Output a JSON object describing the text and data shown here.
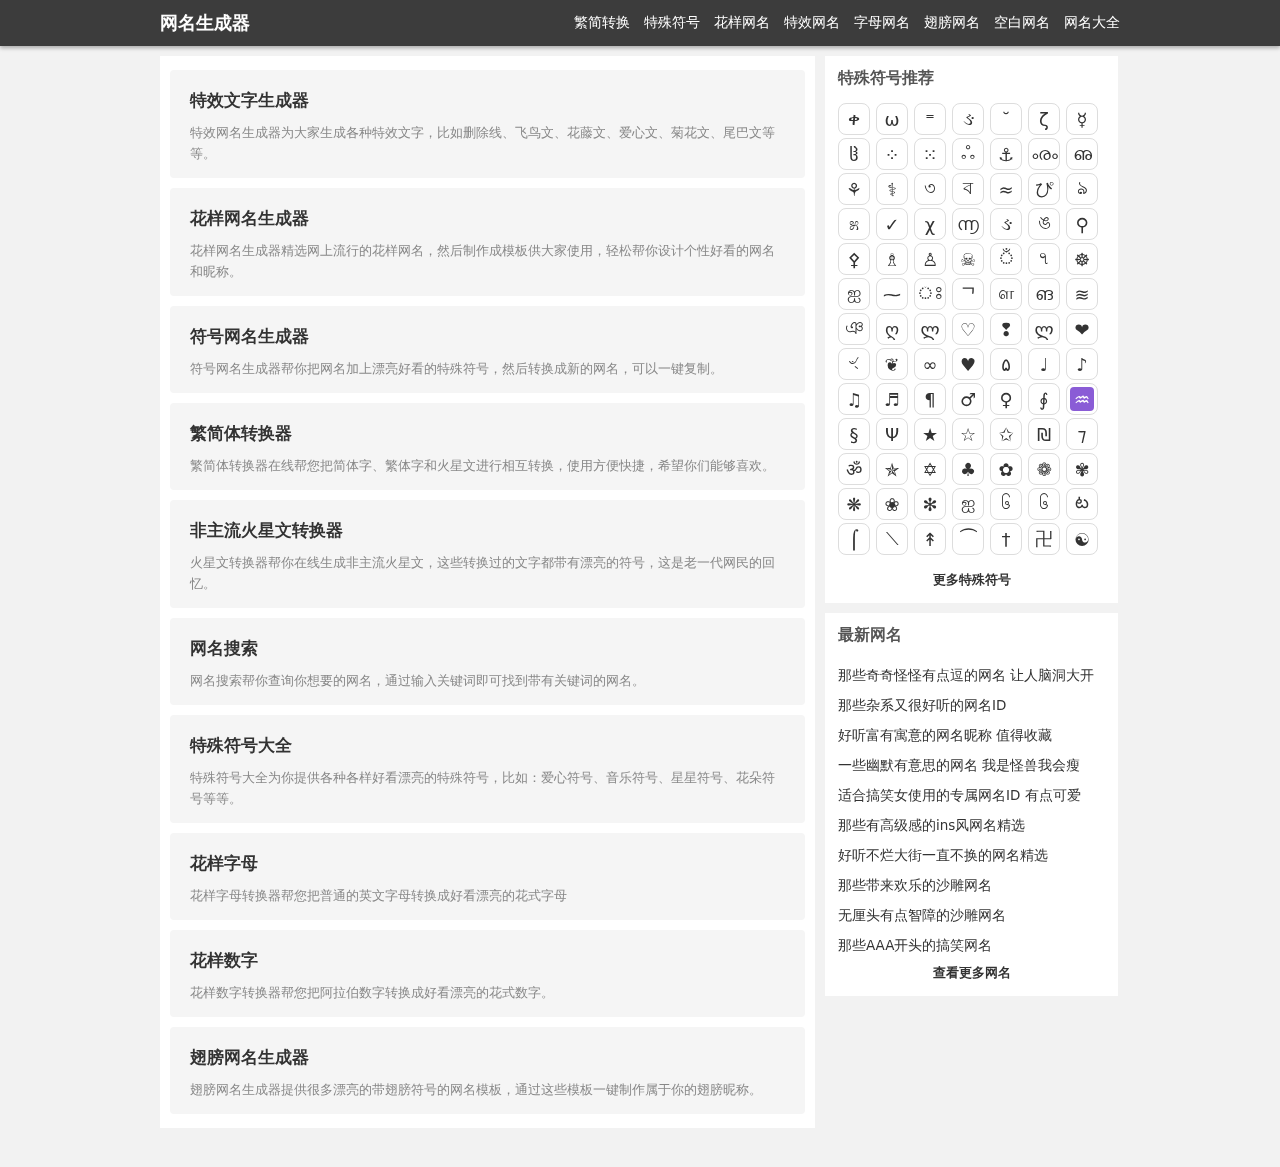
{
  "header": {
    "logo": "网名生成器",
    "nav": [
      {
        "label": "繁简转换"
      },
      {
        "label": "特殊符号"
      },
      {
        "label": "花样网名"
      },
      {
        "label": "特效网名"
      },
      {
        "label": "字母网名"
      },
      {
        "label": "翅膀网名"
      },
      {
        "label": "空白网名"
      },
      {
        "label": "网名大全"
      }
    ]
  },
  "tools": [
    {
      "title": "特效文字生成器",
      "description": "特效网名生成器为大家生成各种特效文字，比如删除线、飞鸟文、花藤文、爱心文、菊花文、尾巴文等等。"
    },
    {
      "title": "花样网名生成器",
      "description": "花样网名生成器精选网上流行的花样网名，然后制作成模板供大家使用，轻松帮你设计个性好看的网名和昵称。"
    },
    {
      "title": "符号网名生成器",
      "description": "符号网名生成器帮你把网名加上漂亮好看的特殊符号，然后转换成新的网名，可以一键复制。"
    },
    {
      "title": "繁简体转换器",
      "description": "繁简体转换器在线帮您把简体字、繁体字和火星文进行相互转换，使用方便快捷，希望你们能够喜欢。"
    },
    {
      "title": "非主流火星文转换器",
      "description": "火星文转换器帮你在线生成非主流火星文，这些转换过的文字都带有漂亮的符号，这是老一代网民的回忆。"
    },
    {
      "title": "网名搜索",
      "description": "网名搜索帮你查询你想要的网名，通过输入关键词即可找到带有关键词的网名。"
    },
    {
      "title": "特殊符号大全",
      "description": "特殊符号大全为你提供各种各样好看漂亮的特殊符号，比如：爱心符号、音乐符号、星星符号、花朵符号等等。"
    },
    {
      "title": "花样字母",
      "description": "花样字母转换器帮您把普通的英文字母转换成好看漂亮的花式字母"
    },
    {
      "title": "花样数字",
      "description": "花样数字转换器帮您把阿拉伯数字转换成好看漂亮的花式数字。"
    },
    {
      "title": "翅膀网名生成器",
      "description": "翅膀网名生成器提供很多漂亮的带翅膀符号的网名模板，通过这些模板一键制作属于你的翅膀昵称。"
    }
  ],
  "symbols_panel": {
    "title": "特殊符号推荐",
    "symbols": [
      {
        "s": "ቀ",
        "kind": "plain"
      },
      {
        "s": "ω",
        "kind": "plain"
      },
      {
        "s": "⁼",
        "kind": "plain"
      },
      {
        "s": "ઙ",
        "kind": "plain"
      },
      {
        "s": "˘",
        "kind": "plain"
      },
      {
        "s": "ζ",
        "kind": "plain"
      },
      {
        "s": "☿",
        "kind": "plain"
      },
      {
        "s": "ჱ",
        "kind": "plain"
      },
      {
        "s": "⁘",
        "kind": "plain"
      },
      {
        "s": "⁙",
        "kind": "plain"
      },
      {
        "s": "ஃ",
        "kind": "plain"
      },
      {
        "s": "⚓",
        "kind": "plain"
      },
      {
        "s": "ൟ",
        "kind": "plain"
      },
      {
        "s": "ഌ",
        "kind": "plain"
      },
      {
        "s": "⚘",
        "kind": "plain"
      },
      {
        "s": "⚕",
        "kind": "plain"
      },
      {
        "s": "৩",
        "kind": "plain"
      },
      {
        "s": "ব",
        "kind": "plain"
      },
      {
        "s": "≈",
        "kind": "plain"
      },
      {
        "s": "ぴ",
        "kind": "plain"
      },
      {
        "s": "ঌ",
        "kind": "plain"
      },
      {
        "s": "೫",
        "kind": "plain"
      },
      {
        "s": "✓",
        "kind": "plain"
      },
      {
        "s": "χ",
        "kind": "plain"
      },
      {
        "s": "൬",
        "kind": "plain"
      },
      {
        "s": "ઙ",
        "kind": "plain"
      },
      {
        "s": "ঙ",
        "kind": "plain"
      },
      {
        "s": "⚲",
        "kind": "plain"
      },
      {
        "s": "⚴",
        "kind": "plain"
      },
      {
        "s": "♗",
        "kind": "plain"
      },
      {
        "s": "♙",
        "kind": "plain"
      },
      {
        "s": "☠",
        "kind": "plain"
      },
      {
        "s": "ঁ",
        "kind": "plain"
      },
      {
        "s": "৭",
        "kind": "plain"
      },
      {
        "s": "☸",
        "kind": "plain"
      },
      {
        "s": "ஐ",
        "kind": "plain"
      },
      {
        "s": "⁓",
        "kind": "plain"
      },
      {
        "s": "ঃ",
        "kind": "plain"
      },
      {
        "s": "ᄀ",
        "kind": "plain"
      },
      {
        "s": "ள",
        "kind": "plain"
      },
      {
        "s": "ങ",
        "kind": "plain"
      },
      {
        "s": "≋",
        "kind": "plain"
      },
      {
        "s": "ঞ",
        "kind": "plain"
      },
      {
        "s": "ღ",
        "kind": "plain"
      },
      {
        "s": "ლ",
        "kind": "plain"
      },
      {
        "s": "♡",
        "kind": "plain"
      },
      {
        "s": "❢",
        "kind": "plain"
      },
      {
        "s": "ლ",
        "kind": "plain"
      },
      {
        "s": "❤",
        "kind": "plain"
      },
      {
        "s": "ৼ",
        "kind": "plain"
      },
      {
        "s": "❦",
        "kind": "plain"
      },
      {
        "s": "∞",
        "kind": "plain"
      },
      {
        "s": "♥",
        "kind": "plain"
      },
      {
        "s": "۵",
        "kind": "plain"
      },
      {
        "s": "♩",
        "kind": "plain"
      },
      {
        "s": "♪",
        "kind": "plain"
      },
      {
        "s": "♫",
        "kind": "plain"
      },
      {
        "s": "♬",
        "kind": "plain"
      },
      {
        "s": "¶",
        "kind": "plain"
      },
      {
        "s": "♂",
        "kind": "plain"
      },
      {
        "s": "♀",
        "kind": "plain"
      },
      {
        "s": "∮",
        "kind": "plain"
      },
      {
        "s": "♒",
        "kind": "tile"
      },
      {
        "s": "§",
        "kind": "plain"
      },
      {
        "s": "Ψ",
        "kind": "plain"
      },
      {
        "s": "★",
        "kind": "plain"
      },
      {
        "s": "☆",
        "kind": "plain"
      },
      {
        "s": "✩",
        "kind": "plain"
      },
      {
        "s": "₪",
        "kind": "plain"
      },
      {
        "s": "⁊",
        "kind": "plain"
      },
      {
        "s": "ॐ",
        "kind": "plain"
      },
      {
        "s": "✯",
        "kind": "plain"
      },
      {
        "s": "✡",
        "kind": "plain"
      },
      {
        "s": "♣",
        "kind": "plain"
      },
      {
        "s": "✿",
        "kind": "plain"
      },
      {
        "s": "❁",
        "kind": "plain"
      },
      {
        "s": "✾",
        "kind": "plain"
      },
      {
        "s": "❋",
        "kind": "plain"
      },
      {
        "s": "❀",
        "kind": "plain"
      },
      {
        "s": "✻",
        "kind": "plain"
      },
      {
        "s": "ஐ",
        "kind": "plain"
      },
      {
        "s": "၆",
        "kind": "plain"
      },
      {
        "s": "၆",
        "kind": "plain"
      },
      {
        "s": "ట",
        "kind": "plain"
      },
      {
        "s": "⌠",
        "kind": "plain"
      },
      {
        "s": "⟍",
        "kind": "plain"
      },
      {
        "s": "↟",
        "kind": "plain"
      },
      {
        "s": "⏜",
        "kind": "plain"
      },
      {
        "s": "†",
        "kind": "plain"
      },
      {
        "s": "卍",
        "kind": "plain"
      },
      {
        "s": "☯",
        "kind": "plain"
      }
    ],
    "more": "更多特殊符号"
  },
  "latest_panel": {
    "title": "最新网名",
    "items": [
      "那些奇奇怪怪有点逗的网名 让人脑洞大开",
      "那些杂系又很好听的网名ID",
      "好听富有寓意的网名昵称 值得收藏",
      "一些幽默有意思的网名 我是怪兽我会瘦",
      "适合搞笑女使用的专属网名ID 有点可爱",
      "那些有高级感的ins风网名精选",
      "好听不烂大街一直不换的网名精选",
      "那些带来欢乐的沙雕网名",
      "无厘头有点智障的沙雕网名",
      "那些AAA开头的搞笑网名"
    ],
    "more": "查看更多网名"
  }
}
